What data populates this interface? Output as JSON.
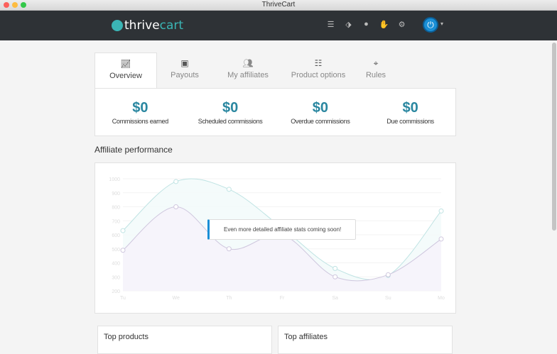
{
  "window": {
    "title": "ThriveCart"
  },
  "header": {
    "logo_a": "thrive",
    "logo_b": "cart",
    "icons": [
      "list-icon",
      "ticket-icon",
      "user-icon",
      "handshake-icon",
      "gear-icon"
    ]
  },
  "tabs": [
    {
      "label": "Overview",
      "icon": "chart-line-icon"
    },
    {
      "label": "Payouts",
      "icon": "money-icon"
    },
    {
      "label": "My affiliates",
      "icon": "users-icon"
    },
    {
      "label": "Product options",
      "icon": "sliders-icon"
    },
    {
      "label": "Rules",
      "icon": "crosshair-icon"
    }
  ],
  "stats": [
    {
      "value": "$0",
      "label": "Commissions earned"
    },
    {
      "value": "$0",
      "label": "Scheduled commissions"
    },
    {
      "value": "$0",
      "label": "Overdue commissions"
    },
    {
      "value": "$0",
      "label": "Due commissions"
    }
  ],
  "performance": {
    "title": "Affiliate performance",
    "notice": "Even more detailed affiliate stats coming soon!"
  },
  "chart_data": {
    "type": "area",
    "x": [
      "Tu",
      "We",
      "Th",
      "Fr",
      "Sa",
      "Su",
      "Mo"
    ],
    "ylim": [
      200,
      1000
    ],
    "yticks": [
      200,
      300,
      400,
      500,
      600,
      700,
      800,
      900,
      1000
    ],
    "series": [
      {
        "name": "series-1",
        "color": "#bfe3e3",
        "values": [
          630,
          980,
          925,
          650,
          360,
          310,
          770
        ]
      },
      {
        "name": "series-2",
        "color": "#cfc7de",
        "values": [
          490,
          800,
          500,
          600,
          300,
          315,
          570
        ]
      }
    ]
  },
  "cards": {
    "top_products": "Top products",
    "top_affiliates": "Top affiliates"
  }
}
